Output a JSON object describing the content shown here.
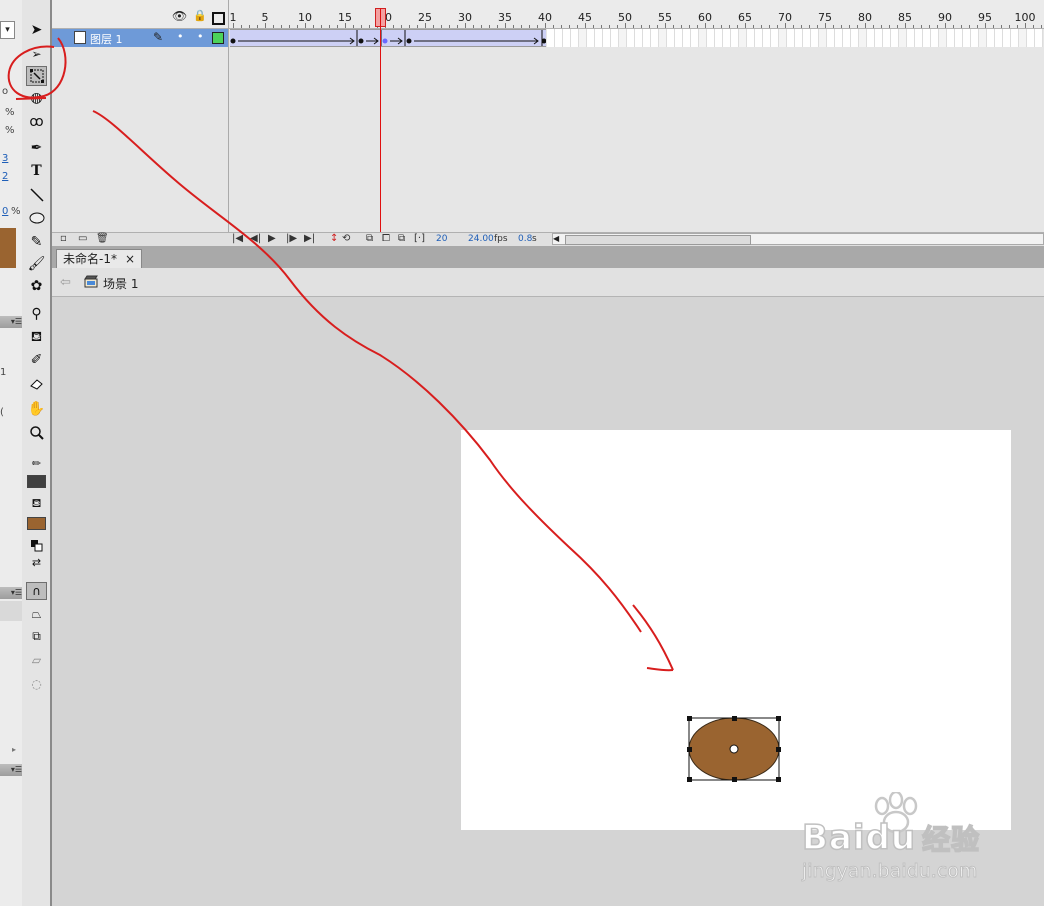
{
  "left_panel": {
    "dropdown_glyph": "▾",
    "frag_o": "o",
    "pct1": "%",
    "pct2": "%",
    "num3": "3",
    "num2": "2",
    "num0": "0",
    "pct3": "%",
    "num1": "1",
    "paren": "(",
    "color_swatch": "#9a6430"
  },
  "tools": {
    "stroke_color": "#404040",
    "fill_color": "#9a6430",
    "selected_tool": "free-transform"
  },
  "timeline": {
    "layer_name": "图层 1",
    "ruler_labels": [
      "1",
      "5",
      "10",
      "15",
      "20",
      "25",
      "30",
      "35",
      "40",
      "45",
      "50",
      "55",
      "60",
      "65",
      "70",
      "75",
      "80",
      "85",
      "90",
      "95",
      "100"
    ],
    "current_frame": "20",
    "fps": "24.00",
    "fps_unit": "fps",
    "elapsed": "0.8",
    "elapsed_unit": "s"
  },
  "document": {
    "tab_title": "未命名-1*",
    "tab_close": "×",
    "scene_label": "场景 1",
    "back_arrow": "⇦"
  },
  "stage": {
    "background": "#ffffff",
    "shape_fill": "#9a6430",
    "annotation_color": "#d81e1e"
  },
  "watermark": {
    "brand": "Bai",
    "brand_du": "du",
    "brand_cn": "经验",
    "url": "jingyan.baidu.com"
  }
}
